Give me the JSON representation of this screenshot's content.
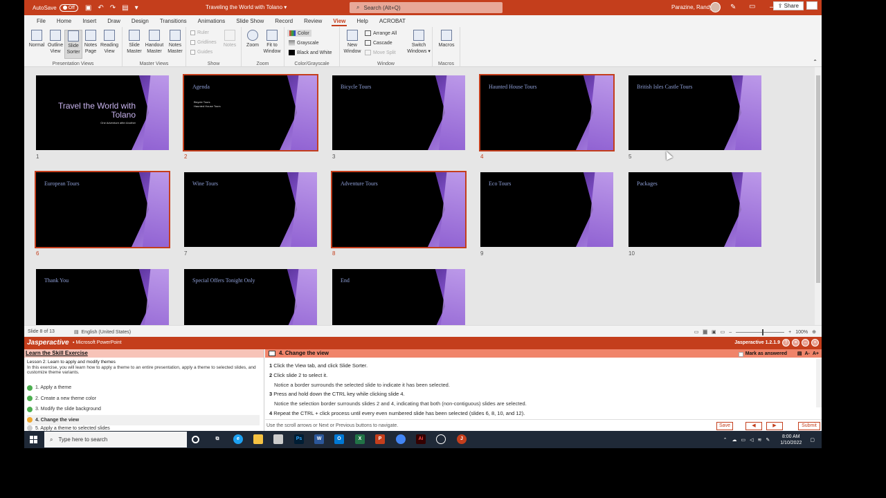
{
  "titlebar": {
    "autosave_label": "AutoSave",
    "autosave_state": "Off",
    "doc_title": "Traveling the World with Tolano",
    "search_placeholder": "Search (Alt+Q)",
    "user_name": "Parazine, Randy"
  },
  "tabs": [
    "File",
    "Home",
    "Insert",
    "Draw",
    "Design",
    "Transitions",
    "Animations",
    "Slide Show",
    "Record",
    "Review",
    "View",
    "Help",
    "ACROBAT"
  ],
  "active_tab": "View",
  "share_label": "Share",
  "ribbon": {
    "presentation_views": {
      "label": "Presentation Views",
      "buttons": [
        "Normal",
        "Outline View",
        "Slide Sorter",
        "Notes Page",
        "Reading View"
      ],
      "selected": "Slide Sorter"
    },
    "master_views": {
      "label": "Master Views",
      "buttons": [
        "Slide Master",
        "Handout Master",
        "Notes Master"
      ]
    },
    "show": {
      "label": "Show",
      "items": [
        "Ruler",
        "Gridlines",
        "Guides"
      ],
      "notes": "Notes"
    },
    "zoom": {
      "label": "Zoom",
      "buttons": [
        "Zoom",
        "Fit to Window"
      ]
    },
    "color": {
      "label": "Color/Grayscale",
      "items": [
        "Color",
        "Grayscale",
        "Black and White"
      ]
    },
    "window": {
      "label": "Window",
      "new_window": "New Window",
      "items": [
        "Arrange All",
        "Cascade",
        "Move Split"
      ],
      "switch": "Switch Windows"
    },
    "macros": {
      "label": "Macros",
      "button": "Macros"
    }
  },
  "slides": [
    {
      "num": "1",
      "title": "Travel the World with Tolano",
      "subtitle": "One Adventure after Another",
      "selected": false
    },
    {
      "num": "2",
      "title": "Agenda",
      "bullets": [
        "Bicycle Tours",
        "Haunted House Tours"
      ],
      "selected": true
    },
    {
      "num": "3",
      "title": "Bicycle Tours",
      "selected": false
    },
    {
      "num": "4",
      "title": "Haunted House Tours",
      "selected": true
    },
    {
      "num": "5",
      "title": "British Isles Castle Tours",
      "selected": false
    },
    {
      "num": "6",
      "title": "European Tours",
      "selected": true
    },
    {
      "num": "7",
      "title": "Wine Tours",
      "selected": false
    },
    {
      "num": "8",
      "title": "Adventure Tours",
      "selected": true
    },
    {
      "num": "9",
      "title": "Eco Tours",
      "selected": false
    },
    {
      "num": "10",
      "title": "Packages",
      "selected": false
    },
    {
      "num": "",
      "title": "Thank You",
      "selected": false
    },
    {
      "num": "",
      "title": "Special Offers Tonight Only",
      "selected": false
    },
    {
      "num": "",
      "title": "End",
      "selected": false
    }
  ],
  "status": {
    "slide_info": "Slide 8 of 13",
    "language": "English (United States)",
    "zoom": "100%"
  },
  "jasper": {
    "logo": "Jasperactive",
    "product": "Microsoft PowerPoint",
    "version": "Jasperactive 1.2.1.9",
    "left_header": "Learn the Skill Exercise",
    "lesson_title": "Lesson 2: Learn to apply and modify themes",
    "lesson_desc": "In this exercise, you will learn how to apply a theme to an entire presentation, apply a theme to selected slides, and customize theme variants.",
    "steps": [
      {
        "label": "1. Apply a theme",
        "state": "done"
      },
      {
        "label": "2. Create a new theme color",
        "state": "done"
      },
      {
        "label": "3. Modify the slide background",
        "state": "done"
      },
      {
        "label": "4. Change the view",
        "state": "current"
      },
      {
        "label": "5. Apply a theme to selected slides",
        "state": "todo"
      }
    ],
    "right_header": "4. Change the view",
    "mark_answered": "Mark as answered",
    "instructions": [
      {
        "n": "1",
        "text": "Click the View tab, and click Slide Sorter."
      },
      {
        "n": "2",
        "text": "Click slide 2 to select it."
      },
      {
        "n": "",
        "text": "Notice a border surrounds the selected slide to indicate it has been selected."
      },
      {
        "n": "3",
        "text": "Press and hold down the CTRL key while clicking slide 4."
      },
      {
        "n": "",
        "text": "Notice the selection border surrounds slides 2 and 4, indicating that both (non-contiguous) slides are selected."
      },
      {
        "n": "4",
        "text": "Repeat the CTRL + click process until every even numbered slide has been selected (slides 6, 8, 10, and 12)."
      }
    ],
    "footer_msg": "Use the scroll arrows or Next or Previous buttons to navigate.",
    "save": "Save",
    "submit": "Submit"
  },
  "taskbar": {
    "search_placeholder": "Type here to search",
    "time": "8:00 AM",
    "date": "1/10/2022"
  }
}
